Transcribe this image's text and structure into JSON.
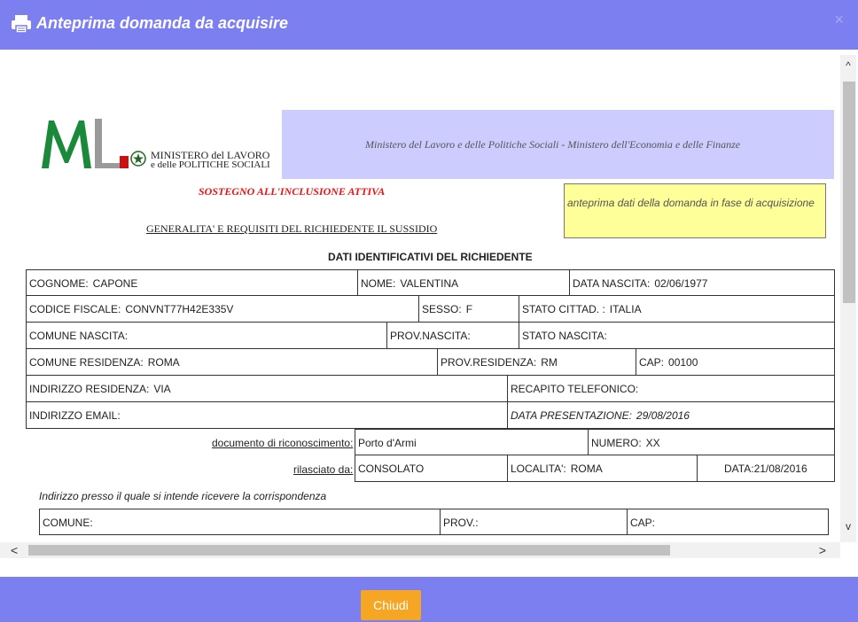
{
  "dialog": {
    "title": "Anteprima domanda da acquisire",
    "close_symbol": "×"
  },
  "banner": {
    "ministry_line1": "MINISTERO del LAVORO",
    "ministry_line2": "e delle POLITICHE SOCIALI",
    "header_text": "Ministero del Lavoro e delle Politiche Sociali - Ministero dell'Economia e delle Finanze"
  },
  "program_title": "SOSTEGNO ALL'INCLUSIONE ATTIVA",
  "preview_note": "anteprima dati della domanda in fase di acquisizione",
  "section_heading": "GENERALITA' E REQUISITI DEL RICHIEDENTE IL SUSSIDIO",
  "identity_title": "DATI IDENTIFICATIVI DEL RICHIEDENTE",
  "fields": {
    "cognome": {
      "label": "COGNOME:",
      "value": "CAPONE"
    },
    "nome": {
      "label": "NOME:",
      "value": "VALENTINA"
    },
    "data_nascita": {
      "label": "DATA NASCITA:",
      "value": "02/06/1977"
    },
    "codice_fiscale": {
      "label": "CODICE FISCALE:",
      "value": "CONVNT77H42E335V"
    },
    "sesso": {
      "label": "SESSO:",
      "value": "F"
    },
    "stato_cittad": {
      "label": "STATO CITTAD. :",
      "value": "ITALIA"
    },
    "comune_nascita": {
      "label": "COMUNE NASCITA:",
      "value": ""
    },
    "prov_nascita": {
      "label": "PROV.NASCITA:",
      "value": ""
    },
    "stato_nascita": {
      "label": "STATO NASCITA:",
      "value": ""
    },
    "comune_residenza": {
      "label": "COMUNE RESIDENZA:",
      "value": "ROMA"
    },
    "prov_residenza": {
      "label": "PROV.RESIDENZA:",
      "value": "RM"
    },
    "cap": {
      "label": "CAP:",
      "value": "00100"
    },
    "indirizzo_residenza": {
      "label": "INDIRIZZO RESIDENZA:",
      "value": "VIA"
    },
    "recapito_telefonico": {
      "label": "RECAPITO TELEFONICO:",
      "value": ""
    },
    "indirizzo_email": {
      "label": "INDIRIZZO EMAIL:",
      "value": ""
    },
    "data_presentazione": {
      "label": "DATA PRESENTAZIONE:",
      "value": "29/08/2016"
    }
  },
  "document": {
    "doc_label": "documento di riconoscimento:",
    "doc_value": "Porto d'Armi",
    "numero_label": "NUMERO:",
    "numero_value": "XX",
    "rilasciato_label": "rilasciato da:",
    "rilasciato_value": "CONSOLATO",
    "localita_label": "LOCALITA':",
    "localita_value": "ROMA",
    "data_label": "DATA:",
    "data_value": "21/08/2016"
  },
  "correspondence": {
    "title": "Indirizzo presso il quale si intende ricevere la corrispondenza",
    "comune_label": "COMUNE:",
    "comune_value": "",
    "prov_label": "PROV.:",
    "prov_value": "",
    "cap_label": "CAP:",
    "cap_value": ""
  },
  "scrollbars": {
    "up": "^",
    "down": "v",
    "left": "<",
    "right": ">"
  },
  "footer": {
    "close_button": "Chiudi"
  },
  "colors": {
    "header": "#7b7ff0",
    "banner": "#ccccff",
    "note_bg": "#ffff99",
    "button": "#f5a623",
    "program_title": "#ee1111"
  }
}
